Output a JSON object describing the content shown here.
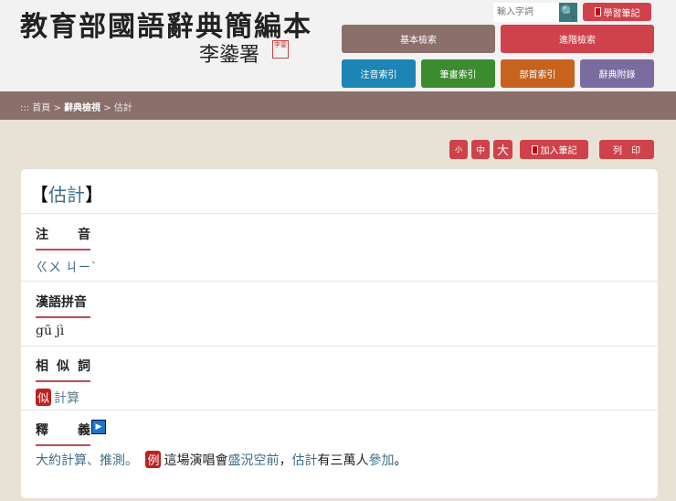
{
  "header": {
    "logo": "教育部國語辭典簡編本",
    "signature": "李鍌署",
    "seal": "李鍌",
    "search_placeholder": "輸入字詞",
    "notes_label": "學習筆記"
  },
  "nav": {
    "basic": "基本檢索",
    "advanced": "進階檢索",
    "zhuyin_index": "注音索引",
    "stroke_index": "筆畫索引",
    "radical_index": "部首索引",
    "appendix": "辭典附錄"
  },
  "breadcrumb": {
    "prefix": ":::",
    "home": "首頁",
    "sep": ">",
    "view": "辭典檢視",
    "current": "估計"
  },
  "tools": {
    "small": "小",
    "medium": "中",
    "large": "大",
    "add_note": "加入筆記",
    "print": "列　印"
  },
  "entry": {
    "open": "【",
    "word": "估計",
    "close": "】",
    "zhuyin_h": [
      "注",
      "音"
    ],
    "zhuyin": "ㄍㄨ ㄐㄧˋ",
    "pinyin_h": "漢語拼音",
    "pinyin": "gū jì",
    "syn_h": [
      "相",
      "似",
      "詞"
    ],
    "syn_tag": "似",
    "syn": "計算",
    "def_h": [
      "釋",
      "義"
    ],
    "def": "大約計算、推測。",
    "ex_tag": "例",
    "ex": [
      "這場演唱會",
      "盛況空前",
      "，",
      "估計",
      "有三萬人",
      "參加",
      "。"
    ]
  }
}
